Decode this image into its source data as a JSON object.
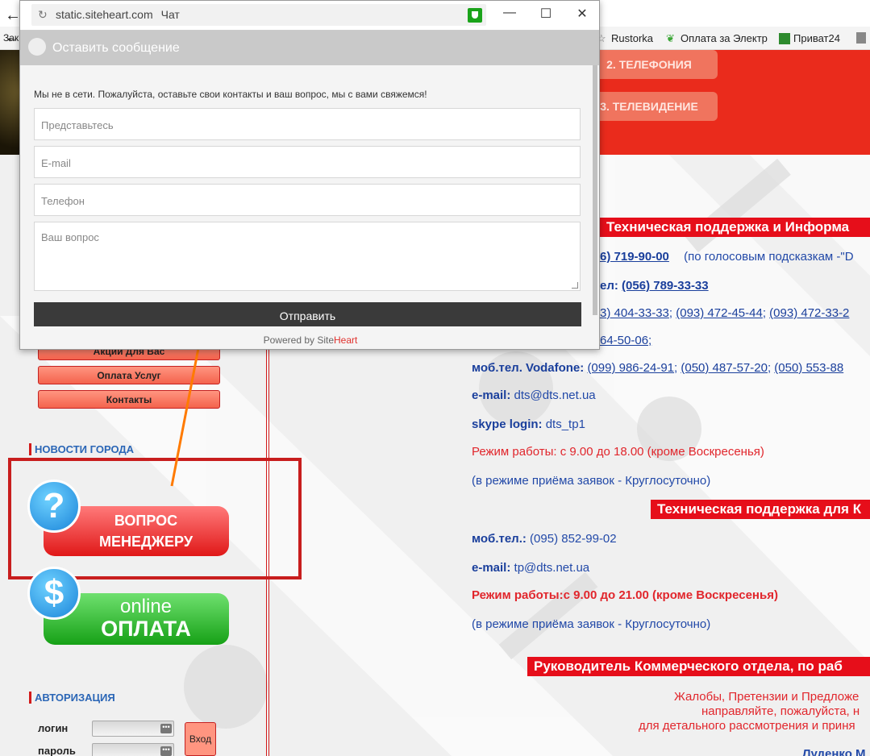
{
  "browser": {
    "back_icon": "←",
    "bookmarks_cut": "Зак",
    "bookmarks": [
      {
        "label": "Rustorka",
        "icon": "star-icon",
        "color": "#7a7a7a"
      },
      {
        "label": "Оплата за Электр",
        "icon": "leaf-icon",
        "color": "#3aa635"
      },
      {
        "label": "Приват24",
        "icon": "privat-icon",
        "color": "#2e8b2e"
      }
    ]
  },
  "banner": {
    "btn2": "2. ТЕЛЕФОНИЯ",
    "btn3": "3. ТЕЛЕВИДЕНИЕ"
  },
  "chat": {
    "url": "static.siteheart.com",
    "window_label": "Чат",
    "minimize": "—",
    "maximize": "☐",
    "close": "✕",
    "header_title": "Оставить сообщение",
    "offline_msg": "Мы не в сети. Пожалуйста, оставьте свои контакты и ваш вопрос, мы с вами свяжемся!",
    "name_placeholder": "Представьтесь",
    "email_placeholder": "E-mail",
    "phone_placeholder": "Телефон",
    "question_placeholder": "Ваш вопрос",
    "send": "Отправить",
    "powered": "Powered by ",
    "powered_site": "Site",
    "powered_heart": "Heart"
  },
  "left_menu": {
    "items": [
      "Акции Для Вас",
      "Оплата Услуг",
      "Контакты"
    ],
    "news_head": "НОВОСТИ ГОРОДА",
    "question_btn": [
      "ВОПРОС",
      "МЕНЕДЖЕРУ"
    ],
    "question_icon": "?",
    "pay_icon": "$",
    "pay_btn": [
      "online",
      "ОПЛАТА"
    ],
    "auth_head": "АВТОРИЗАЦИЯ",
    "login_label": "логин",
    "password_label": "пароль",
    "login_btn": "Вход"
  },
  "content": {
    "head1": "Техническая поддержка и Информа",
    "phone1": "6) 719-90-00",
    "phone1_note": "(по голосовым подсказкам -\"D",
    "tel_label": "ел:",
    "tel_value": "(056) 789-33-33",
    "line3": [
      "3) 404-33-33",
      "(093) 472-45-44",
      "(093) 472-33-2"
    ],
    "line4": "64-50-06;",
    "vodafone_label": "моб.тел. Vodafone:",
    "vodafone": [
      "(099) 986-24-91",
      "(050) 487-57-20",
      "(050) 553-88"
    ],
    "email_label": "e-mail:",
    "email": "dts@dts.net.ua",
    "skype_label": "skype login:",
    "skype": "dts_tp1",
    "hours1": "Режим работы: с 9.00 до 18.00 (кроме Воскресенья)",
    "requests1": "(в режиме приёма заявок - Круглосуточно)",
    "head2": "Техническая поддержка для К",
    "mob_label": "моб.тел.:",
    "mob": "(095) 852-99-02",
    "email2_label": "e-mail:",
    "email2": "tp@dts.net.ua",
    "hours2": "Режим работы:с 9.00 до 21.00 (кроме Воскресенья)",
    "requests2": "(в режиме приёма заявок - Круглосуточно)",
    "head3": "Руководитель Коммерческого отдела, по раб",
    "complaints1": "Жалобы, Претензии и Предложе",
    "complaints2": "направляйте, пожалуйста, н",
    "complaints3": "для детального рассмотрения и приня",
    "person": "Луденко М"
  },
  "colors": {
    "accent_red": "#e60e1a",
    "link_blue": "#2249a8",
    "annotation_arrow": "#ff7a00",
    "highlight_frame": "#c81e1e"
  }
}
